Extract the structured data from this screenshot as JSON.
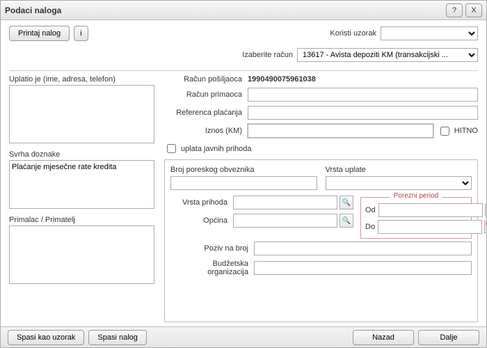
{
  "window": {
    "title": "Podaci naloga"
  },
  "toolbar": {
    "print_label": "Printaj nalog",
    "info_label": "i",
    "template_label": "Koristi uzorak",
    "template_value": "",
    "account_label": "Izaberite račun",
    "account_value": "13617 - Avista depoziti KM (transakcijski ..."
  },
  "left": {
    "payer_label": "Uplatio je (ime, adresa, telefon)",
    "payer_value": "",
    "purpose_label": "Svrha doznake",
    "purpose_value": "Plaćanje mjesečne rate kredita",
    "payee_label": "Primalac / Primatelj",
    "payee_value": ""
  },
  "right": {
    "sender_account_label": "Račun pošiljaoca",
    "sender_account_value": "1990490075961038",
    "recipient_account_label": "Račun primaoca",
    "recipient_account_value": "",
    "payment_ref_label": "Referenca plaćanja",
    "payment_ref_value": "",
    "amount_label": "Iznos (KM)",
    "amount_value": "",
    "urgent_label": "HITNO",
    "public_revenue_label": "uplata javnih prihoda"
  },
  "group": {
    "tax_no_label": "Broj poreskog obveznika",
    "tax_no_value": "",
    "payment_type_label": "Vrsta uplate",
    "payment_type_value": "",
    "revenue_type_label": "Vrsta prihoda",
    "revenue_type_value": "",
    "municipality_label": "Općina",
    "municipality_value": "",
    "call_no_label": "Poziv na broj",
    "call_no_value": "",
    "budget_org_label": "Budžetska organizacija",
    "budget_org_value": "",
    "period_legend": "Porezni period",
    "from_label": "Od",
    "from_value": "",
    "to_label": "Do",
    "to_value": ""
  },
  "footer": {
    "save_template_label": "Spasi kao uzorak",
    "save_order_label": "Spasi nalog",
    "back_label": "Nazad",
    "next_label": "Dalje"
  }
}
